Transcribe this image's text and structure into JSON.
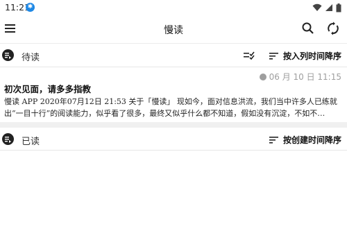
{
  "status": {
    "time": "11:21",
    "bluetooth": "฿"
  },
  "app": {
    "title": "慢读"
  },
  "to_read": {
    "title": "待读",
    "sort_label": "按入列时间降序",
    "articles": [
      {
        "time": "06 月 10 日 11:15",
        "title": "初次见面，请多多指教",
        "summary": "慢读 APP 2020年07月12日 21:53 关于「慢读」 现如今，面对信息洪流，我们当中许多人已练就出“一目十行”的阅读能力，似乎看了很多，最终又似乎什么都不知道，假如没有沉淀，不如不…"
      }
    ]
  },
  "read": {
    "title": "已读",
    "sort_label": "按创建时间降序"
  },
  "icons": {
    "menu": "menu-icon",
    "search": "search-icon",
    "sync": "sync-icon",
    "section": "playlist-icon",
    "sort": "sort-icon",
    "select": "checklist-icon",
    "wifi": "wifi-icon",
    "signal": "signal-icon",
    "battery": "battery-icon"
  },
  "colors": {
    "accent": "#1e88e5",
    "muted": "#9e9e9e",
    "band": "#f0f0f0"
  }
}
